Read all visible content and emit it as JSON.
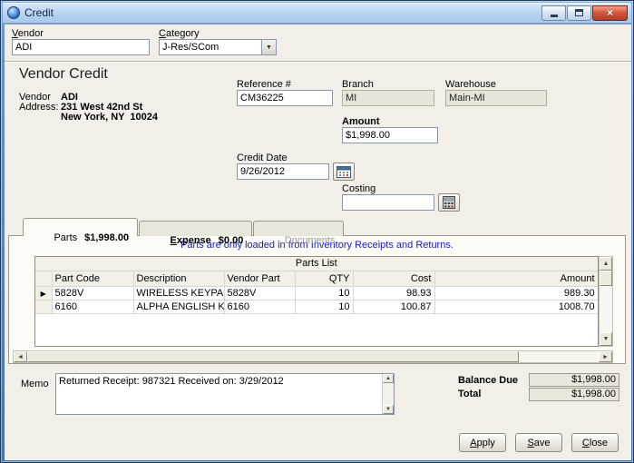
{
  "window": {
    "title": "Credit"
  },
  "colors": {
    "frame_blue": "#5380b2",
    "notice_blue": "#1a1acc",
    "close_red": "#b23a22"
  },
  "icons": {
    "dropdown_arrow": "▼",
    "scroll_up": "▲",
    "scroll_down": "▼",
    "scroll_left": "◄",
    "scroll_right": "►",
    "row_selector": "▶",
    "close": "×"
  },
  "header": {
    "vendor_label": "Vendor",
    "vendor_value": "ADI",
    "category_label": "Category",
    "category_value": "J-Res/SCom"
  },
  "form": {
    "title": "Vendor Credit",
    "vendor_label": "Vendor",
    "address_label": "Address:",
    "vendor_name": "ADI",
    "address_line1": "231 West 42nd St",
    "address_line2": "New York, NY  10024",
    "reference_label": "Reference #",
    "reference_value": "CM36225",
    "branch_label": "Branch",
    "branch_value": "MI",
    "warehouse_label": "Warehouse",
    "warehouse_value": "Main-MI",
    "amount_label": "Amount",
    "amount_value": "$1,998.00",
    "credit_date_label": "Credit Date",
    "credit_date_value": "9/26/2012",
    "costing_label": "Costing",
    "costing_value": ""
  },
  "tabs": {
    "parts": {
      "label": "Parts",
      "amount": "$1,998.00"
    },
    "expense": {
      "label": "Expense",
      "amount": "$0.00"
    },
    "documents": {
      "label": "Documents"
    }
  },
  "parts_panel": {
    "notice": "Parts are only loaded in from Inventory Receipts and Returns.",
    "table_title": "Parts List",
    "columns": [
      "Part Code",
      "Description",
      "Vendor Part",
      "QTY",
      "Cost",
      "Amount"
    ],
    "rows": [
      {
        "part_code": "5828V",
        "description": "WIRELESS KEYPAD W",
        "vendor_part": "5828V",
        "qty": "10",
        "cost": "98.93",
        "amount": "989.30"
      },
      {
        "part_code": "6160",
        "description": "ALPHA ENGLISH KEYF",
        "vendor_part": "6160",
        "qty": "10",
        "cost": "100.87",
        "amount": "1008.70"
      }
    ]
  },
  "footer": {
    "memo_label": "Memo",
    "memo_value": "Returned Receipt: 987321 Received on: 3/29/2012",
    "balance_due_label": "Balance Due",
    "balance_due_value": "$1,998.00",
    "total_label": "Total",
    "total_value": "$1,998.00",
    "apply_label": "Apply",
    "save_label": "Save",
    "close_label": "Close"
  }
}
